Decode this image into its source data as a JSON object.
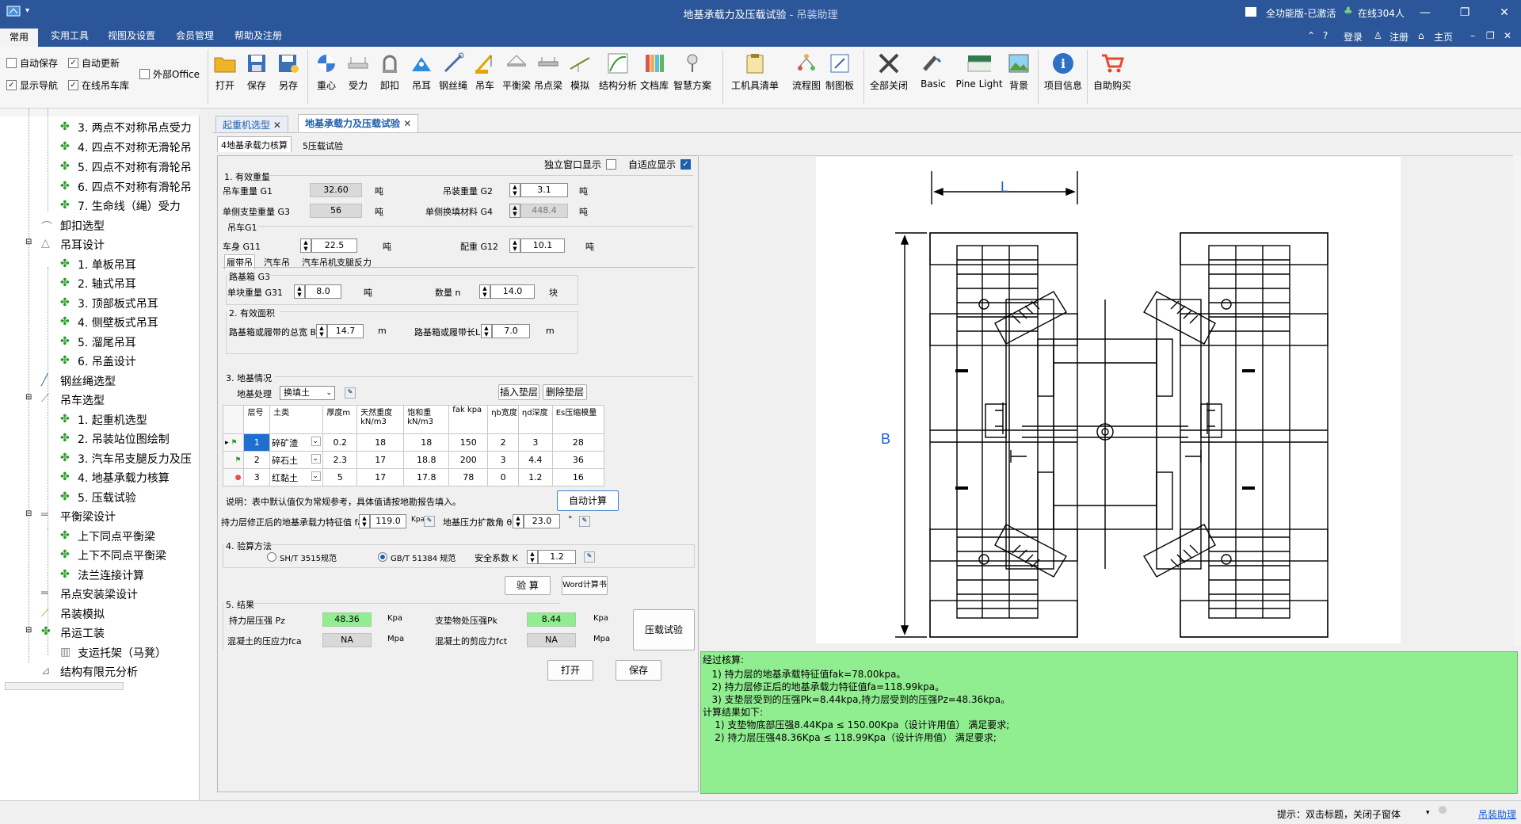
{
  "titlebar": {
    "title": "地基承载力及压载试验",
    "subtitle": " - 吊装助理",
    "edition": "全功能版-已激活",
    "online": "在线304人"
  },
  "menu": {
    "tabs": [
      "常用",
      "实用工具",
      "视图及设置",
      "会员管理",
      "帮助及注册"
    ],
    "login": "登录",
    "register": "注册",
    "home": "主页"
  },
  "ribbon": {
    "checks": [
      {
        "label": "自动保存",
        "checked": false
      },
      {
        "label": "自动更新",
        "checked": true
      },
      {
        "label": "外部Office",
        "checked": false
      },
      {
        "label": "显示导航",
        "checked": true
      },
      {
        "label": "在线吊车库",
        "checked": true
      }
    ],
    "buttons": [
      "打开",
      "保存",
      "另存",
      "重心",
      "受力",
      "卸扣",
      "吊耳",
      "钢丝绳",
      "吊车",
      "平衡梁",
      "吊点梁",
      "模拟",
      "结构分析",
      "文档库",
      "智慧方案",
      "工机具清单",
      "流程图",
      "制图板",
      "全部关闭",
      "Basic",
      "Pine Light",
      "背景",
      "项目信息",
      "自助购买"
    ]
  },
  "sidebar": {
    "items": [
      "3. 两点不对称吊点受力",
      "4. 四点不对称无滑轮吊",
      "5. 四点不对称有滑轮吊",
      "6. 四点不对称有滑轮吊",
      "7. 生命线（绳）受力",
      "卸扣选型",
      "吊耳设计",
      "1. 单板吊耳",
      "2. 轴式吊耳",
      "3. 顶部板式吊耳",
      "4. 侧壁板式吊耳",
      "5. 溜尾吊耳",
      "6. 吊盖设计",
      "钢丝绳选型",
      "吊车选型",
      "1. 起重机选型",
      "2. 吊装站位图绘制",
      "3. 汽车吊支腿反力及压",
      "4. 地基承载力核算",
      "5. 压载试验",
      "平衡梁设计",
      "上下同点平衡梁",
      "上下不同点平衡梁",
      "法兰连接计算",
      "吊点安装梁设计",
      "吊装模拟",
      "吊运工装",
      "支运托架（马凳）",
      "结构有限元分析"
    ]
  },
  "doc_tabs": [
    "起重机选型",
    "地基承载力及压载试验"
  ],
  "inner_tabs": [
    "4地基承载力核算",
    "5压载试验"
  ],
  "top_opts": {
    "independent": "独立窗口显示",
    "adaptive": "自适应显示"
  },
  "weights": {
    "section": "1. 有效重量",
    "g1_label": "吊车重量 G1",
    "g1": "32.60",
    "unit_t": "吨",
    "g2_label": "吊装重量 G2",
    "g2": "3.1",
    "g3_label": "单侧支垫重量 G3",
    "g3": "56",
    "g4_label": "单侧换填材料 G4",
    "g4": "448.4",
    "crane_group": "吊车G1",
    "g11_label": "车身 G11",
    "g11": "22.5",
    "g12_label": "配重 G12",
    "g12": "10.1",
    "subtabs": [
      "履带吊",
      "汽车吊",
      "汽车吊机支腿反力"
    ],
    "mat_group": "路基箱 G3",
    "g31_label": "单块重量 G31",
    "g31": "8.0",
    "n_label": "数量 n",
    "n": "14.0",
    "unit_block": "块"
  },
  "area": {
    "section": "2. 有效面积",
    "b_label": "路基箱或履带的总宽 B",
    "b": "14.7",
    "l_label": "路基箱或履带长L",
    "l": "7.0",
    "unit_m": "m"
  },
  "ground": {
    "section": "3. 地基情况",
    "treat_label": "地基处理",
    "treat": "换填土",
    "insert_btn": "插入垫层",
    "delete_btn": "删除垫层",
    "headers": [
      "层号",
      "土类",
      "厚度m",
      "天然重度kN/m3",
      "饱和重kN/m3",
      "fak kpa",
      "ηb宽度",
      "ηd深度",
      "Es压缩模量"
    ],
    "rows": [
      [
        "1",
        "碎矿渣",
        "0.2",
        "18",
        "18",
        "150",
        "2",
        "3",
        "28"
      ],
      [
        "2",
        "碎石土",
        "2.3",
        "17",
        "18.8",
        "200",
        "3",
        "4.4",
        "36"
      ],
      [
        "3",
        "红黏土",
        "5",
        "17",
        "17.8",
        "78",
        "0",
        "1.2",
        "16"
      ]
    ],
    "note": "说明：表中默认值仅为常规参考，具体值请按地勘报告填入。",
    "auto_btn": "自动计算",
    "fa_label": "持力层修正后的地基承载力特征值 fa",
    "fa": "119.0",
    "unit_kpa_lower": "Kpa",
    "theta_label": "地基压力扩散角 θ",
    "theta": "23.0",
    "unit_deg": "°"
  },
  "method": {
    "section": "4. 验算方法",
    "opt1": "SH/T 3515规范",
    "opt2": "GB/T 51384 规范",
    "k_label": "安全系数 K",
    "k": "1.2",
    "calc_btn": "验 算",
    "word_btn": "Word计算书"
  },
  "results": {
    "section": "5. 结果",
    "pz_label": "持力层压强 Pz",
    "pz": "48.36",
    "unit_kpa": "Kpa",
    "pk_label": "支垫物处压强Pk",
    "pk": "8.44",
    "fca_label": "混凝土的压应力fca",
    "fca": "NA",
    "unit_mpa": "Mpa",
    "fct_label": "混凝土的剪应力fct",
    "fct": "NA",
    "ballast_btn": "压载试验",
    "open_btn": "打开",
    "save_btn": "保存"
  },
  "drawing": {
    "dim_l": "L",
    "dim_b": "B"
  },
  "output_text": [
    "经过核算:",
    "   1) 持力层的地基承载特征值fak=78.00kpa。",
    "   2) 持力层修正后的地基承载力特征值fa=118.99kpa。",
    "   3) 支垫层受到的压强Pk=8.44kpa,持力层受到的压强Pz=48.36kpa。",
    "计算结果如下:",
    "    1) 支垫物底部压强8.44Kpa ≤ 150.00Kpa（设计许用值） 满足要求;",
    "    2) 持力层压强48.36Kpa ≤ 118.99Kpa（设计许用值） 满足要求;"
  ],
  "statusbar": {
    "hint": "提示：双击标题，关闭子窗体",
    "link": "吊装助理"
  },
  "colors": {
    "title_blue": "#2b579a",
    "result_green": "#90ee90",
    "tab_blue": "#1f5fa8"
  }
}
